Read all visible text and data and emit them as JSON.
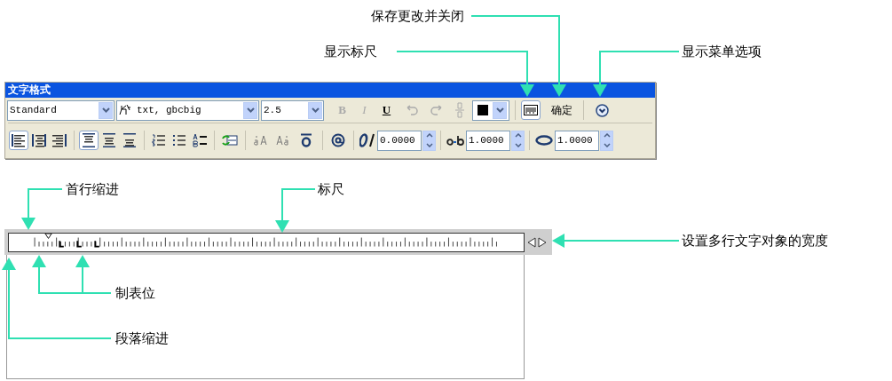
{
  "toolbar": {
    "title": "文字格式",
    "style_select": "Standard",
    "font_select": "txt, gbcbig",
    "height_select": "2.5",
    "format_buttons": [
      {
        "label": "B",
        "kind": "bold",
        "disabled": true
      },
      {
        "label": "I",
        "kind": "italic",
        "disabled": true
      },
      {
        "label": "U",
        "kind": "underline",
        "disabled": false
      }
    ],
    "show_ruler": {
      "selected": true
    },
    "ok_button": "确定",
    "paragraph_align": [
      {
        "kind": "left",
        "selected": true
      },
      {
        "kind": "center",
        "selected": false
      },
      {
        "kind": "right",
        "selected": false
      }
    ],
    "vertical_align": [
      {
        "kind": "top",
        "selected": true
      },
      {
        "kind": "middle",
        "selected": false
      },
      {
        "kind": "bottom",
        "selected": false
      }
    ],
    "oblique_angle": "0.0000",
    "tracking": "1.0000",
    "width_factor": "1.0000"
  },
  "callouts": [
    {
      "text": "保存更改并关闭"
    },
    {
      "text": "显示标尺"
    },
    {
      "text": "显示菜单选项"
    },
    {
      "text": "首行缩进"
    },
    {
      "text": "标尺"
    },
    {
      "text": "设置多行文字对象的宽度"
    },
    {
      "text": "制表位"
    },
    {
      "text": "段落缩进"
    }
  ]
}
